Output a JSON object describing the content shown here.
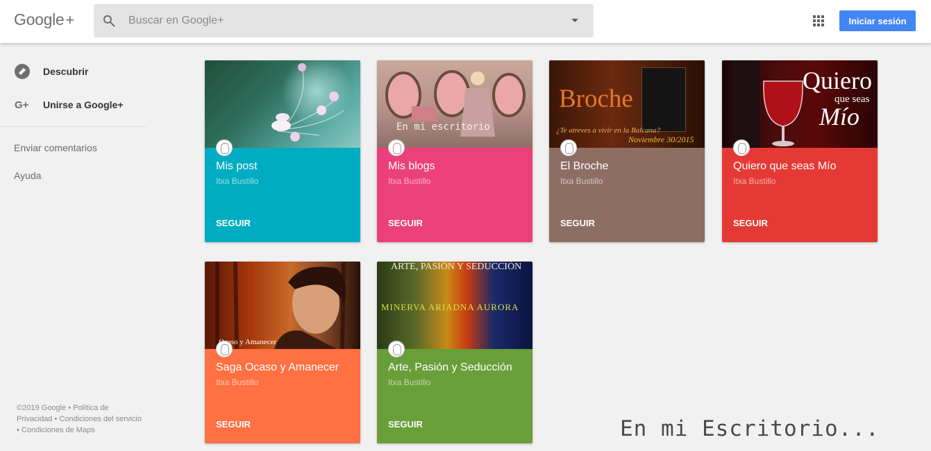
{
  "header": {
    "logo": "Google",
    "logo_plus": "+",
    "search_placeholder": "Buscar en Google+",
    "signin_label": "Iniciar sesión"
  },
  "sidebar": {
    "items": [
      {
        "label": "Descubrir",
        "icon": "compass-icon"
      },
      {
        "label": "Unirse a Google+",
        "icon": "google-plus-icon"
      }
    ],
    "gplus_glyph": "G+",
    "links": [
      "Enviar comentarios",
      "Ayuda"
    ],
    "footer": "©2019 Google • Política de Privacidad • Condiciones del servicio • Condiciones de Maps"
  },
  "cards": [
    {
      "title": "Mis post",
      "owner": "Itxa Bustillo",
      "follow": "SEGUIR",
      "color": "#00acc1"
    },
    {
      "title": "Mis blogs",
      "owner": "Itxa Bustillo",
      "follow": "SEGUIR",
      "color": "#ec407a",
      "image_text": "En mi escritorio"
    },
    {
      "title": "El Broche",
      "owner": "Itxa Bustillo",
      "follow": "SEGUIR",
      "color": "#8d6e63",
      "image_text": "Broche",
      "image_subtext": "¿Te atreves a vivir en la Balcana?",
      "image_date": "Noviembre 30/2015"
    },
    {
      "title": "Quiero que seas Mío",
      "owner": "Itxa Bustillo",
      "follow": "SEGUIR",
      "color": "#e53935",
      "image_text": "Quiero",
      "image_subtext": "que seas",
      "image_text2": "Mío"
    },
    {
      "title": "Saga Ocaso y Amanecer",
      "owner": "Itxa Bustillo",
      "follow": "SEGUIR",
      "color": "#ff7043",
      "image_text": "Ocaso y Amanecer"
    },
    {
      "title": "Arte, Pasión y Seducción",
      "owner": "Itxa Bustillo",
      "follow": "SEGUIR",
      "color": "#689f38",
      "image_text": "ARTE, PASIÓN Y SEDUCCIÓN",
      "image_names": "MINERVA  ARIADNA  AURORA"
    }
  ],
  "watermark": "En mi Escritorio..."
}
